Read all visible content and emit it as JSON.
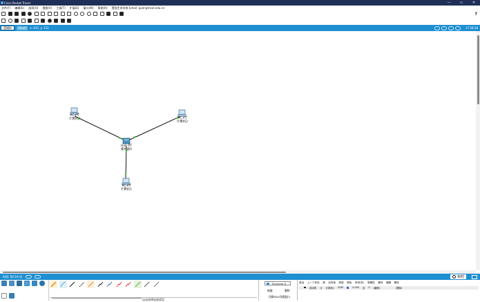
{
  "window": {
    "title": "Cisco Packet Tracer",
    "controls": [
      "—",
      "▭",
      "✕"
    ]
  },
  "menubar": {
    "items": [
      "文件(F)",
      "编辑(E)",
      "选项(O)",
      "视图(V)",
      "工具(T)",
      "扩展(E)",
      "窗口(W)",
      "帮助(H)",
      "登陆生命学校 Email: guer@mcol.edu.cn"
    ]
  },
  "toolbar": {
    "help": "?"
  },
  "workspace_bar": {
    "tab_label": "逻辑的",
    "root_label": "[Root]",
    "coords": "x: 435, y: 152",
    "time": "17:28:38"
  },
  "topology": {
    "nodes": [
      {
        "id": "pc0",
        "type": "PC-PT",
        "name": "计算机0"
      },
      {
        "id": "pc2",
        "type": "PC-PT",
        "name": "计算机2"
      },
      {
        "id": "hub0",
        "type": "Hub-PT",
        "name": "集线器0"
      },
      {
        "id": "pc1",
        "type": "PC-PT",
        "name": "计算机1"
      }
    ],
    "links": [
      {
        "from": "pc0",
        "to": "hub0"
      },
      {
        "from": "pc2",
        "to": "hub0"
      },
      {
        "from": "pc1",
        "to": "hub0"
      }
    ]
  },
  "status_bar": {
    "time": "时间: 00:34:41",
    "realtime_label": "实时"
  },
  "device_panel": {
    "connection_type_label": "自动选择连接类型"
  },
  "scenario": {
    "selected": "Scenario 0",
    "new_label": "新建",
    "delete_label": "删除",
    "switch_label": "切换PDU列表窗口"
  },
  "pdu_table": {
    "headers": [
      "激活",
      "上一个状态",
      "源",
      "目的地",
      "类型",
      "颜色",
      "时间(秒)",
      "周期性",
      "编号",
      "编辑",
      "删除"
    ],
    "rows": [
      {
        "status": "成功的",
        "source": "计",
        "destination": "计算机1",
        "type": "ICMP",
        "color": "#3b5fd1",
        "time": "0.000",
        "periodic": "否",
        "num": "0",
        "edit": "(编辑)",
        "delete": "(删除)"
      }
    ]
  },
  "colors": {
    "titlebar": "#1f2f57",
    "accent": "#1e8fd0",
    "link_ok": "#3cd23c"
  }
}
